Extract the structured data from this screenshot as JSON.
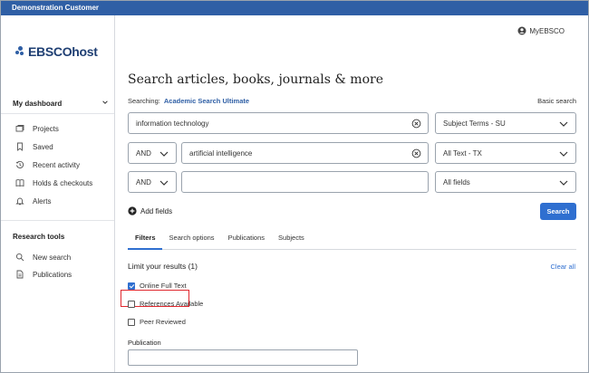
{
  "topbar": {
    "title": "Demonstration Customer"
  },
  "logo": {
    "text": "EBSCOhost"
  },
  "sidebar": {
    "dashboard_title": "My dashboard",
    "dashboard_items": [
      {
        "label": "Projects",
        "icon": "projects-icon"
      },
      {
        "label": "Saved",
        "icon": "bookmark-icon"
      },
      {
        "label": "Recent activity",
        "icon": "history-icon"
      },
      {
        "label": "Holds & checkouts",
        "icon": "book-icon"
      },
      {
        "label": "Alerts",
        "icon": "bell-icon"
      }
    ],
    "tools_title": "Research tools",
    "tools_items": [
      {
        "label": "New search",
        "icon": "search-icon"
      },
      {
        "label": "Publications",
        "icon": "document-icon"
      }
    ]
  },
  "header": {
    "myebsco_label": "MyEBSCO"
  },
  "search": {
    "title": "Search articles, books, journals & more",
    "searching_label": "Searching:",
    "database": "Academic Search Ultimate",
    "basic_search_link": "Basic search",
    "rows": [
      {
        "operator": "",
        "query": "information technology",
        "field": "Subject Terms - SU"
      },
      {
        "operator": "AND",
        "query": "artificial intelligence",
        "field": "All Text - TX"
      },
      {
        "operator": "AND",
        "query": "",
        "field": "All fields"
      }
    ],
    "add_fields_label": "Add fields",
    "search_button": "Search"
  },
  "tabs": [
    {
      "label": "Filters",
      "active": true
    },
    {
      "label": "Search options",
      "active": false
    },
    {
      "label": "Publications",
      "active": false
    },
    {
      "label": "Subjects",
      "active": false
    }
  ],
  "filters": {
    "limit_title": "Limit your results (1)",
    "clear_all": "Clear all",
    "checkboxes": [
      {
        "label": "Online Full Text",
        "checked": true
      },
      {
        "label": "References Available",
        "checked": false
      },
      {
        "label": "Peer Reviewed",
        "checked": false
      }
    ],
    "publication_label": "Publication",
    "publication_value": ""
  },
  "colors": {
    "topbar": "#2f5fa5",
    "accent": "#2f6fd0",
    "highlight": "#e0282e"
  }
}
